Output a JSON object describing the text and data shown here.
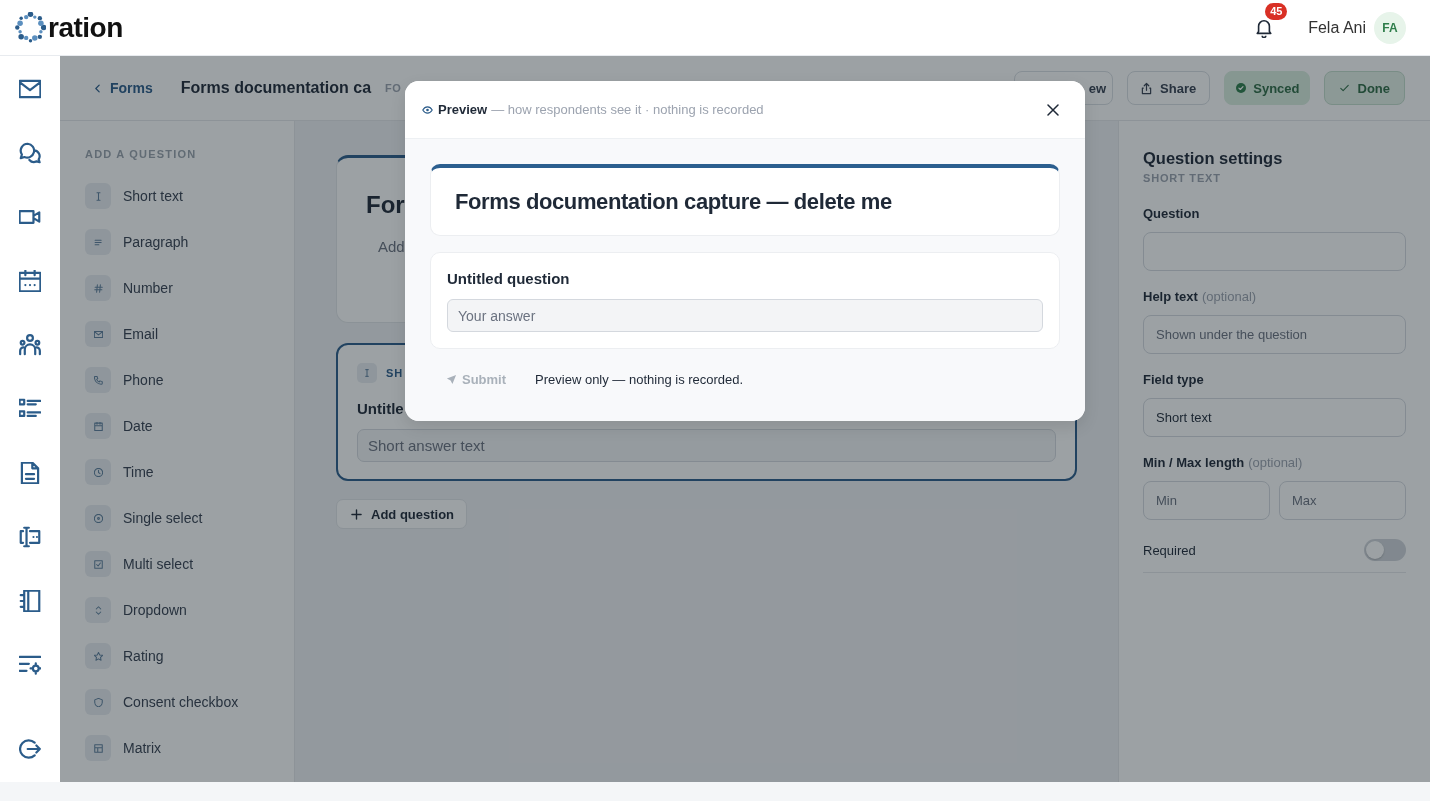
{
  "top_bar": {
    "brand": "ration",
    "notifications": {
      "count": "45"
    },
    "user": {
      "name": "Fela Ani",
      "initials": "FA"
    }
  },
  "editor_header": {
    "back_link": "Forms",
    "title": "Forms documentation ca",
    "tag": "FO",
    "actions": [
      {
        "kind": "preview",
        "label": "ew"
      },
      {
        "kind": "share",
        "label": "Share"
      },
      {
        "kind": "synced",
        "label": "Synced"
      },
      {
        "kind": "done",
        "label": "Done"
      }
    ]
  },
  "question_palette": {
    "heading": "ADD A QUESTION",
    "items": [
      {
        "kind": "short_text",
        "label": "Short text"
      },
      {
        "kind": "paragraph",
        "label": "Paragraph"
      },
      {
        "kind": "number",
        "label": "Number"
      },
      {
        "kind": "email",
        "label": "Email"
      },
      {
        "kind": "phone",
        "label": "Phone"
      },
      {
        "kind": "date",
        "label": "Date"
      },
      {
        "kind": "time",
        "label": "Time"
      },
      {
        "kind": "single_select",
        "label": "Single select"
      },
      {
        "kind": "multi_select",
        "label": "Multi select"
      },
      {
        "kind": "dropdown",
        "label": "Dropdown"
      },
      {
        "kind": "rating",
        "label": "Rating"
      },
      {
        "kind": "consent",
        "label": "Consent checkbox"
      },
      {
        "kind": "matrix",
        "label": "Matrix"
      }
    ]
  },
  "form_canvas": {
    "form_title": "For",
    "form_description": "Add",
    "questions": [
      {
        "kind": "short_text",
        "type_label": "SH",
        "title": "Untitle",
        "placeholder": "Short answer text",
        "selected": true
      }
    ],
    "add_button": "Add question"
  },
  "question_settings": {
    "title": "Question settings",
    "subtitle": "SHORT TEXT",
    "fields": [
      {
        "kind": "text",
        "label": "Question"
      },
      {
        "kind": "text",
        "label": "Help text",
        "hint": "(optional)",
        "placeholder": "Shown under the question"
      },
      {
        "kind": "select",
        "label": "Field type",
        "value": "Short text"
      },
      {
        "kind": "range",
        "label": "Min / Max length",
        "hint": "(optional)",
        "placeholders": [
          "Min",
          "Max"
        ]
      }
    ],
    "required": {
      "label": "Required",
      "on": false
    }
  },
  "preview_modal": {
    "title": "Preview",
    "subtitle": "— how respondents see it · nothing is recorded",
    "form_title": "Forms documentation capture — delete me",
    "questions": [
      {
        "title": "Untitled question",
        "placeholder": "Your answer"
      }
    ],
    "submit_label": "Submit",
    "note": "Preview only — nothing is recorded."
  }
}
